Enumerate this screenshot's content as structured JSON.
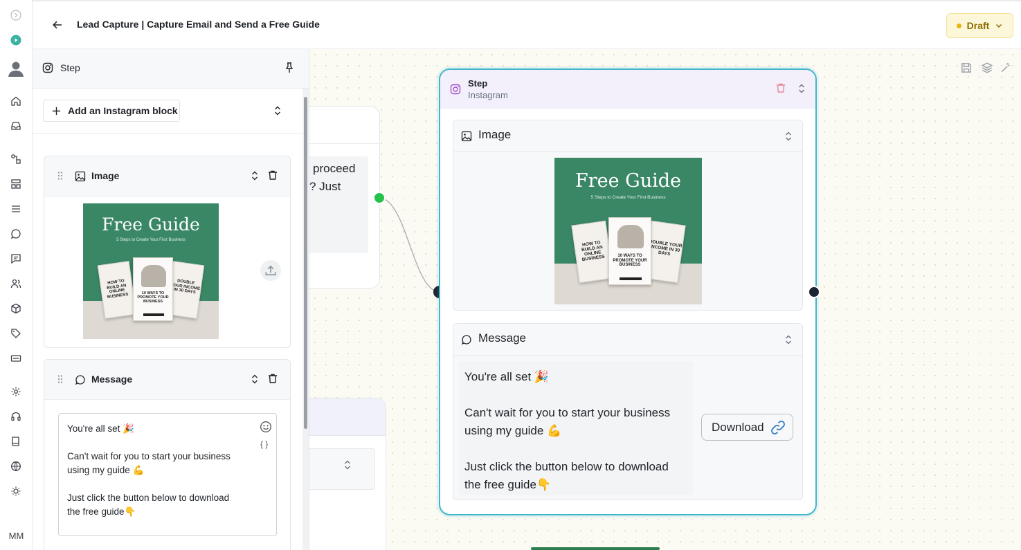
{
  "header": {
    "title": "Lead Capture | Capture Email and Send a Free Guide",
    "status_label": "Draft"
  },
  "rail": {
    "user_initials": "MM"
  },
  "panel": {
    "title": "Step",
    "add_block_label": "Add an Instagram block",
    "image_block": {
      "label": "Image"
    },
    "message_block": {
      "label": "Message",
      "lines": [
        "You're all set 🎉",
        "Can't wait for you to start your business",
        "using my guide 💪",
        "Just click the button below to download",
        "the free guide👇"
      ],
      "variable_label": "{ }"
    }
  },
  "guide_image": {
    "title": "Free Guide",
    "subtitle": "5 Steps to Create Your First Business",
    "book_left": "HOW TO BUILD AN ONLINE BUSINESS",
    "book_main": "10 WAYS TO PROMOTE YOUR BUSINESS",
    "book_right": "DOUBLE YOUR INCOME IN 30 DAYS"
  },
  "canvas": {
    "prev_node_text_1": "proceed",
    "prev_node_text_2": "? Just",
    "node": {
      "title": "Step",
      "subtitle": "Instagram",
      "image_block_label": "Image",
      "message_block_label": "Message",
      "message_lines": [
        "You're all set 🎉",
        "Can't wait for you to start your business",
        "using my guide 💪",
        "Just click the button below to download",
        "the free guide👇"
      ],
      "button_label": "Download"
    }
  },
  "colors": {
    "accent_teal": "#3eb6cc",
    "guide_green": "#3a8766",
    "connector_green": "#27c24c",
    "draft_yellow": "#fdf7d9"
  },
  "icons": {
    "rail": [
      "expand-icon",
      "play-icon",
      "avatar-icon",
      "home-icon",
      "inbox-icon",
      "flows-icon",
      "layout-icon",
      "list-icon",
      "chat-icon",
      "comments-icon",
      "contacts-icon",
      "package-icon",
      "tag-icon",
      "keyboard-icon",
      "settings-icon",
      "support-icon",
      "book-icon",
      "globe-icon",
      "theme-icon"
    ]
  }
}
